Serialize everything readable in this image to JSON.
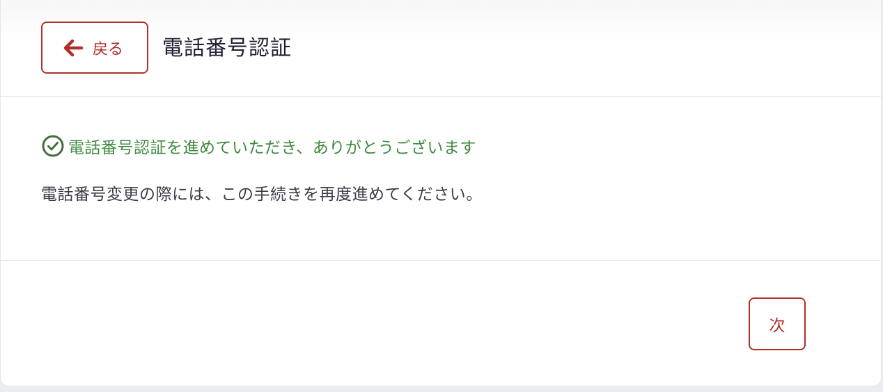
{
  "header": {
    "back_label": "戻る",
    "back_icon": "arrow-left-icon",
    "title": "電話番号認証"
  },
  "main": {
    "success_icon": "check-circle-icon",
    "success_message": "電話番号認証を進めていただき、ありがとうございます",
    "info_message": "電話番号変更の際には、この手続きを再度進めてください。"
  },
  "footer": {
    "next_label": "次"
  },
  "colors": {
    "accent": "#b03028",
    "success": "#3f8a3f",
    "success_icon": "#4a6a44",
    "text": "#3b3c48",
    "title": "#1f2133"
  }
}
